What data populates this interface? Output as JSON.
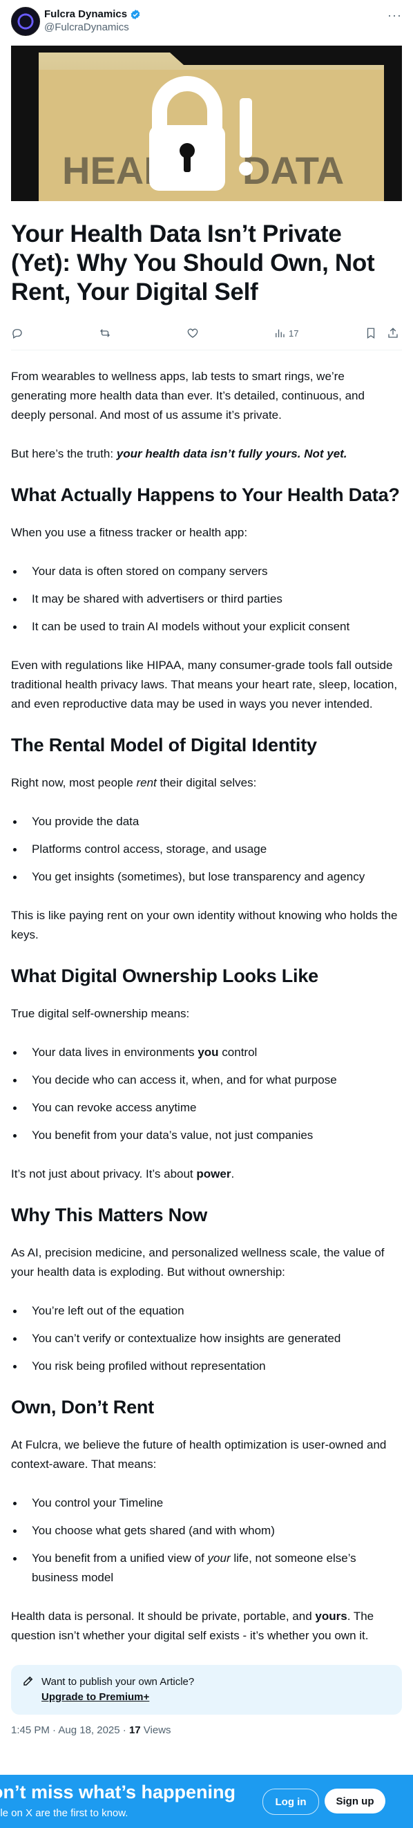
{
  "author": {
    "name": "Fulcra Dynamics",
    "handle": "@FulcraDynamics"
  },
  "hero": {
    "text_left": "HEAL",
    "text_right": "DATA"
  },
  "article": {
    "title": "Your Health Data Isn’t Private (Yet): Why You Should Own, Not Rent, Your Digital Self",
    "views_count": "17",
    "p1": "From wearables to wellness apps, lab tests to smart rings, we’re generating more health data than ever. It’s detailed, continuous, and deeply personal. And most of us assume it’s private.",
    "p2_lead": "But here’s the truth: ",
    "p2_emph": "your health data isn’t fully yours. Not yet.",
    "h_happens": "What Actually Happens to Your Health Data?",
    "p_happens": "When you use a fitness tracker or health app:",
    "list_happens": [
      "Your data is often stored on company servers",
      "It may be shared with advertisers or third parties",
      "It can be used to train AI models without your explicit consent"
    ],
    "p_hipaa": "Even with regulations like HIPAA, many consumer-grade tools fall outside traditional health privacy laws. That means your heart rate, sleep, location, and even reproductive data may be used in ways you never intended.",
    "h_rental": "The Rental Model of Digital Identity",
    "p_rental_a": "Right now, most people ",
    "p_rental_em": "rent",
    "p_rental_b": " their digital selves:",
    "list_rental": [
      "You provide the data",
      "Platforms control access, storage, and usage",
      "You get insights (sometimes), but lose transparency and agency"
    ],
    "p_rent": "This is like paying rent on your own identity without knowing who holds the keys.",
    "h_ownership": "What Digital Ownership Looks Like",
    "p_ownership": "True digital self-ownership means:",
    "own_li1_a": "Your data lives in environments ",
    "own_li1_b": "you",
    "own_li1_c": " control",
    "list_ownership": [
      "You decide who can access it, when, and for what purpose",
      "You can revoke access anytime",
      "You benefit from your data’s value, not just companies"
    ],
    "p_power_a": "It’s not just about privacy. It’s about ",
    "p_power_b": "power",
    "p_power_c": ".",
    "h_now": "Why This Matters Now",
    "p_now": "As AI, precision medicine, and personalized wellness scale, the value of your health data is exploding. But without ownership:",
    "list_now": [
      "You’re left out of the equation",
      "You can’t verify or contextualize how insights are generated",
      "You risk being profiled without representation"
    ],
    "h_own": "Own, Don’t Rent",
    "p_own": "At Fulcra, we believe the future of health optimization is user-owned and context-aware. That means:",
    "list_own": [
      "You control your Timeline",
      "You choose what gets shared (and with whom)"
    ],
    "own_li3_a": "You benefit from a unified view of ",
    "own_li3_em": "your",
    "own_li3_b": " life, not someone else’s business model",
    "p_final_a": "Health data is personal. It should be private, portable, and ",
    "p_final_b": "yours",
    "p_final_c": ". The question isn’t whether your digital self exists - it’s whether you own it."
  },
  "promo": {
    "question": "Want to publish your own Article?",
    "link": "Upgrade to Premium+"
  },
  "meta": {
    "time": "1:45 PM · Aug 18, 2025 · ",
    "views": "17",
    "views_label": " Views"
  },
  "banner": {
    "title": "on’t miss what’s happening",
    "subtitle": "ple on X are the first to know.",
    "login": "Log in",
    "signup": "Sign up"
  },
  "colors": {
    "accent": "#1d9bf0",
    "text": "#0f1419",
    "muted": "#536471",
    "promo_bg": "#e8f5fd"
  }
}
